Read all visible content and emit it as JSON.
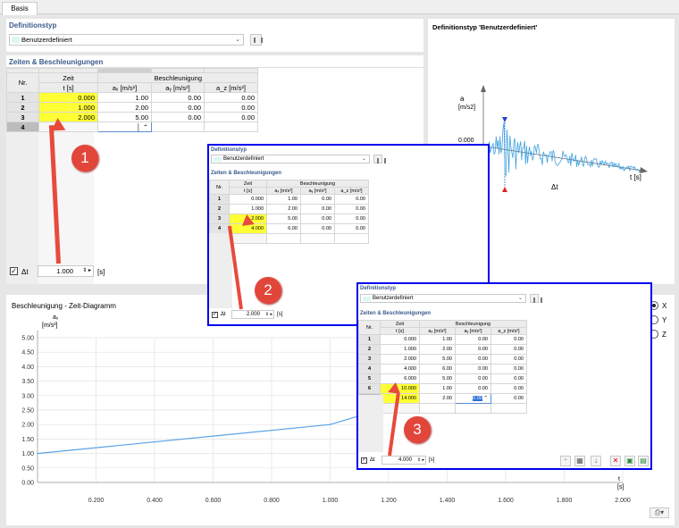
{
  "tab_label": "Basis",
  "main": {
    "def_header": "Definitionstyp",
    "def_value": "Benutzerdefiniert",
    "section": "Zeiten & Beschleunigungen",
    "col_nr": "Nr.",
    "col_time_a": "Zeit",
    "col_time_b": "t [s]",
    "col_accel": "Beschleunigung",
    "col_ax": "aₓ [m/s²]",
    "col_ay": "aᵧ [m/s²]",
    "col_az": "a_z [m/s²]",
    "rows": [
      [
        "1",
        "0.000",
        "1.00",
        "0.00",
        "0.00"
      ],
      [
        "2",
        "1.000",
        "2.00",
        "0.00",
        "0.00"
      ],
      [
        "3",
        "2.000",
        "5.00",
        "0.00",
        "0.00"
      ],
      [
        "4",
        "",
        "",
        "",
        ""
      ]
    ],
    "dt_label": "Δt",
    "dt_value": "1.000",
    "dt_unit": "[s]"
  },
  "right_panel": {
    "title": "Definitionstyp 'Benutzerdefiniert'",
    "a_label": "a",
    "unit_label": "[m/s2]",
    "zero_label": "0.000",
    "t_label": "t [s]",
    "dt_label": "Δt"
  },
  "chart_data": {
    "type": "line",
    "title": "Beschleunigung - Zeit-Diagramm",
    "ylabel_a": "aₓ",
    "ylabel_b": "[m/s²]",
    "xlabel_a": "t",
    "xlabel_b": "[s]",
    "x": [
      0.0,
      1.0,
      2.0
    ],
    "y": [
      1.0,
      2.0,
      5.0
    ],
    "xlim": [
      0.0,
      2.0
    ],
    "ylim": [
      0.0,
      5.0
    ],
    "x_ticks": [
      "0.200",
      "0.400",
      "0.600",
      "0.800",
      "1.000",
      "1.200",
      "1.400",
      "1.600",
      "1.800",
      "2.000"
    ],
    "y_ticks": [
      "0.00",
      "0.50",
      "1.00",
      "1.50",
      "2.00",
      "2.50",
      "3.00",
      "3.50",
      "4.00",
      "4.50",
      "5.00"
    ],
    "line_color": "#5ba3e6",
    "grid": true
  },
  "radios": [
    "X",
    "Y",
    "Z"
  ],
  "step2": {
    "def_header": "Definitionstyp",
    "def_value": "Benutzerdefiniert",
    "section": "Zeiten & Beschleunigungen",
    "col_nr": "Nr.",
    "col_time_a": "Zeit",
    "col_time_b": "t [s]",
    "col_accel": "Beschleunigung",
    "col_ax": "aₓ [m/s²]",
    "col_ay": "aᵧ [m/s²]",
    "col_az": "a_z [m/s²]",
    "rows": [
      [
        "1",
        "0.000",
        "1.00",
        "0.00",
        "0.00"
      ],
      [
        "2",
        "1.000",
        "2.00",
        "0.00",
        "0.00"
      ],
      [
        "3",
        "2.000",
        "5.00",
        "0.00",
        "0.00"
      ],
      [
        "4",
        "4.000",
        "6.00",
        "0.00",
        "0.00"
      ],
      [
        "5",
        "",
        "",
        "",
        ""
      ]
    ],
    "dt_label": "Δt",
    "dt_value": "2.000",
    "dt_unit": "[s]"
  },
  "step3": {
    "def_header": "Definitionstyp",
    "def_value": "Benutzerdefiniert",
    "section": "Zeiten & Beschleunigungen",
    "col_nr": "Nr.",
    "col_time_a": "Zeit",
    "col_time_b": "t [s]",
    "col_accel": "Beschleunigung",
    "col_ax": "aₓ [m/s²]",
    "col_ay": "aᵧ [m/s²]",
    "col_az": "a_z [m/s²]",
    "rows": [
      [
        "1",
        "0.000",
        "1.00",
        "0.00",
        "0.00"
      ],
      [
        "2",
        "1.000",
        "2.00",
        "0.00",
        "0.00"
      ],
      [
        "3",
        "2.000",
        "5.00",
        "0.00",
        "0.00"
      ],
      [
        "4",
        "4.000",
        "6.00",
        "0.00",
        "0.00"
      ],
      [
        "5",
        "6.000",
        "5.00",
        "0.00",
        "0.00"
      ],
      [
        "6",
        "10.000",
        "1.00",
        "0.00",
        "0.00"
      ],
      [
        "7",
        "14.000",
        "2.00",
        "0.00",
        "0.00"
      ],
      [
        "8",
        "",
        "",
        "",
        ""
      ]
    ],
    "dt_label": "Δt",
    "dt_value": "4.000",
    "dt_unit": "[s]"
  },
  "badges": [
    "1",
    "2",
    "3"
  ],
  "colors": {
    "accent_blue": "#0000ee",
    "highlight": "#ffff36",
    "arrow": "#e84a3c"
  }
}
